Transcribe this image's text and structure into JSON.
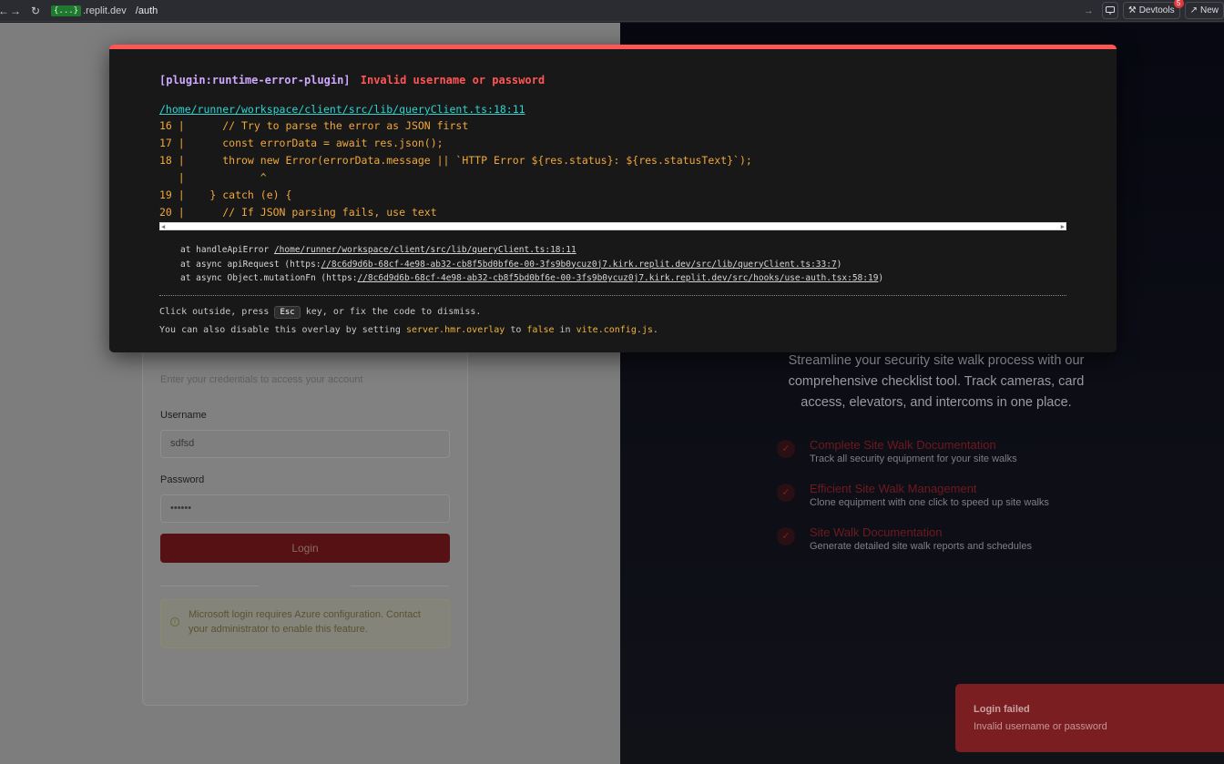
{
  "browser": {
    "url_badge": "{...}",
    "url_domain": ".replit.dev",
    "url_path": "/auth",
    "devtools_label": "Devtools",
    "devtools_badge": "5",
    "new_tab_label": "New"
  },
  "login": {
    "subtitle": "Enter your credentials to access your account",
    "username_label": "Username",
    "username_value": "sdfsd",
    "password_label": "Password",
    "password_value": "••••••",
    "login_button": "Login",
    "microsoft_notice": "Microsoft login requires Azure configuration. Contact your administrator to enable this feature."
  },
  "hero": {
    "tagline": "Streamline your security site walk process with our comprehensive checklist tool. Track cameras, card access, elevators, and intercoms in one place.",
    "features": [
      {
        "title": "Complete Site Walk Documentation",
        "desc": "Track all security equipment for your site walks"
      },
      {
        "title": "Efficient Site Walk Management",
        "desc": "Clone equipment with one click to speed up site walks"
      },
      {
        "title": "Site Walk Documentation",
        "desc": "Generate detailed site walk reports and schedules"
      }
    ]
  },
  "toast": {
    "title": "Login failed",
    "description": "Invalid username or password"
  },
  "error_overlay": {
    "plugin": "[plugin:runtime-error-plugin]",
    "message": "Invalid username or password",
    "file": "/home/runner/workspace/client/src/lib/queryClient.ts:18:11",
    "code_lines": [
      "16 |      // Try to parse the error as JSON first",
      "17 |      const errorData = await res.json();",
      "18 |      throw new Error(errorData.message || `HTTP Error ${res.status}: ${res.statusText}`);",
      "   |            ^",
      "19 |    } catch (e) {",
      "20 |      // If JSON parsing fails, use text"
    ],
    "stack": [
      {
        "prefix": "at handleApiError ",
        "link": "/home/runner/workspace/client/src/lib/queryClient.ts:18:11",
        "suffix": ""
      },
      {
        "prefix": "at async apiRequest (https:",
        "link": "//8c6d9d6b-68cf-4e98-ab32-cb8f5bd0bf6e-00-3fs9b0ycuz0j7.kirk.replit.dev/src/lib/queryClient.ts:33:7",
        "suffix": ")"
      },
      {
        "prefix": "at async Object.mutationFn (https:",
        "link": "//8c6d9d6b-68cf-4e98-ab32-cb8f5bd0bf6e-00-3fs9b0ycuz0j7.kirk.replit.dev/src/hooks/use-auth.tsx:58:19",
        "suffix": ")"
      }
    ],
    "tip1_a": "Click outside, press ",
    "tip1_key": "Esc",
    "tip1_b": " key, or fix the code to dismiss.",
    "tip2_a": "You can also disable this overlay by setting ",
    "tip2_setting": "server.hmr.overlay",
    "tip2_b": " to ",
    "tip2_value": "false",
    "tip2_c": " in ",
    "tip2_file": "vite.config.js",
    "tip2_d": "."
  }
}
